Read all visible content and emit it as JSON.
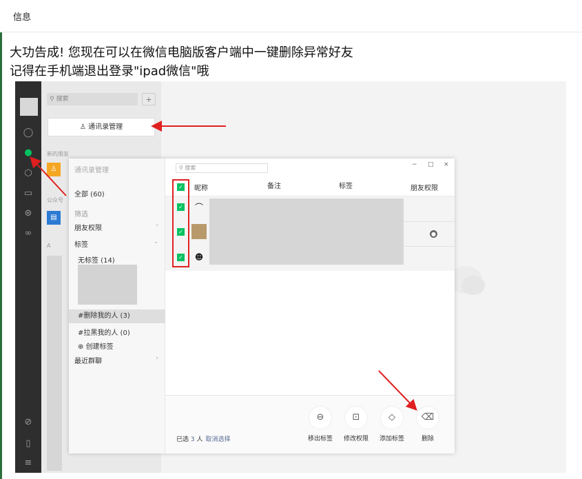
{
  "header": {
    "title": "信息"
  },
  "intro": {
    "line1": "大功告成! 您现在可以在微信电脑版客户端中一键删除异常好友",
    "line2": "记得在手机端退出登录\"ipad微信\"哦"
  },
  "wechat": {
    "search_placeholder": "搜索",
    "add_icon": "add-contact-icon",
    "contacts_manager_button": "通讯录管理",
    "section_new_friends": "新的朋友",
    "section_official": "公众号",
    "section_a": "A",
    "nav_icons": [
      "chat-icon",
      "contacts-icon",
      "cube-icon",
      "folder-icon",
      "moments-icon",
      "miniprogram-icon",
      "link-icon",
      "phone-icon",
      "menu-icon"
    ]
  },
  "manager": {
    "title": "通讯录管理",
    "all": "全部 (60)",
    "filter": "筛选",
    "friend_perm": "朋友权限",
    "tags": "标签",
    "no_tag": "无标签 (14)",
    "tag_deleted": "#删除我的人 (3)",
    "tag_blocked": "#拉黑我的人 (0)",
    "create_tag": "创建标签",
    "recent_group": "最近群聊",
    "search_placeholder": "搜索",
    "col_nickname": "昵称",
    "col_remark": "备注",
    "col_tag": "标签",
    "col_perm": "朋友权限",
    "window_controls": [
      "−",
      "□",
      "×"
    ],
    "selected_prefix": "已选",
    "selected_count": "3",
    "selected_suffix": "人",
    "cancel_select": "取消选择",
    "actions": [
      {
        "label": "移出标签",
        "icon": "remove-tag-icon",
        "glyph": "⊖"
      },
      {
        "label": "修改权限",
        "icon": "lock-icon",
        "glyph": "🔒"
      },
      {
        "label": "添加标签",
        "icon": "tag-icon",
        "glyph": "◇"
      },
      {
        "label": "删除",
        "icon": "trash-icon",
        "glyph": "🗑"
      }
    ]
  },
  "colors": {
    "accent": "#07c160",
    "highlight": "#e02020",
    "link": "#576b95"
  }
}
